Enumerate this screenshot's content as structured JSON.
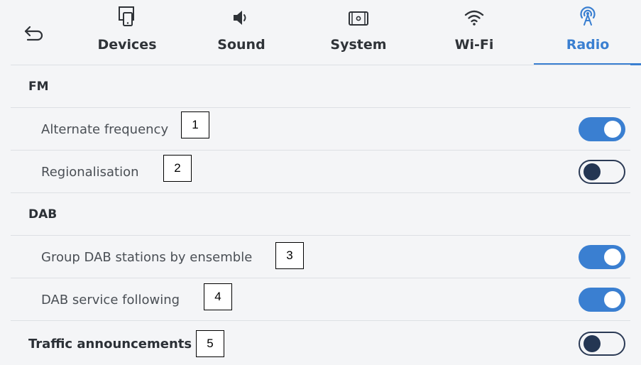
{
  "tabs": [
    {
      "label": "Devices",
      "icon": "phone-device-icon",
      "active": false
    },
    {
      "label": "Sound",
      "icon": "speaker-icon",
      "active": false
    },
    {
      "label": "System",
      "icon": "system-screen-icon",
      "active": false
    },
    {
      "label": "Wi-Fi",
      "icon": "wifi-icon",
      "active": false
    },
    {
      "label": "Radio",
      "icon": "radio-antenna-icon",
      "active": true
    }
  ],
  "sections": {
    "fm": {
      "title": "FM",
      "items": [
        {
          "label": "Alternate frequency",
          "annotation": "1",
          "toggle": "on"
        },
        {
          "label": "Regionalisation",
          "annotation": "2",
          "toggle": "off"
        }
      ]
    },
    "dab": {
      "title": "DAB",
      "items": [
        {
          "label": "Group DAB stations by ensemble",
          "annotation": "3",
          "toggle": "on"
        },
        {
          "label": "DAB service following",
          "annotation": "4",
          "toggle": "on"
        }
      ]
    },
    "traffic": {
      "label": "Traffic announcements",
      "annotation": "5",
      "toggle": "off"
    }
  },
  "colors": {
    "accent": "#3a7fd1",
    "toggle_off_knob": "#243653",
    "background": "#f4f5f7"
  }
}
